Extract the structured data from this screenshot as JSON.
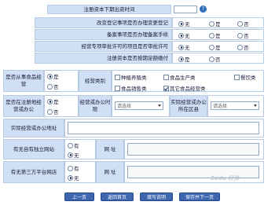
{
  "rows": {
    "reg_capital_deadline": "注册资本下期出资时间",
    "change_reg": "改变登记事项是否办理变更登记",
    "record": "备案事项是否办理备案手续",
    "approval": "经营专项审批许可的项目是否审批许可",
    "capital_paid": "注册资本是否按期足额缴付",
    "other_business": "是否从事食品经营",
    "category": "经营类别",
    "in_place": "是否在注册地经营或办公",
    "actual_company": "经营或办公时限",
    "actual_location": "实际经营或办公所在区县",
    "actual_address": "实际经营或办公地址",
    "has_website": "有无自有独立网站",
    "website_label": "网  址",
    "third_party": "有无第三方平台网店",
    "third_website_label": "网  址"
  },
  "options": {
    "none": "无",
    "yes": "是",
    "no": "否",
    "have": "有",
    "not_have": "无"
  },
  "category_options": [
    "种植养殖类",
    "食品生产类",
    "餐饮类",
    "食品销售类",
    "其它食品经营类"
  ],
  "select_placeholder": "请选择",
  "help_icon": "help-icon",
  "buttons": [
    "上一页",
    "返回首页",
    "填写说明",
    "保存并下一页"
  ],
  "watermark": "Baidu 经验"
}
